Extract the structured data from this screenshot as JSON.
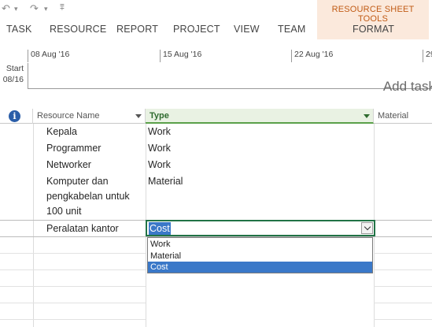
{
  "qat": {
    "undo_glyph": "↶",
    "undo_dd": "▾",
    "redo_glyph": "↷",
    "redo_dd": "▾",
    "customize_glyph": "⩱"
  },
  "ribbon": {
    "context_title": "RESOURCE SHEET TOOLS",
    "tabs": [
      "TASK",
      "RESOURCE",
      "REPORT",
      "PROJECT",
      "VIEW",
      "TEAM",
      "FORMAT"
    ]
  },
  "timeline": {
    "start_label": "Start",
    "start_date": "08/16",
    "ticks": [
      "08 Aug '16",
      "15 Aug '16",
      "22 Aug '16",
      "29"
    ],
    "add_tasks_text": "Add task"
  },
  "sheet": {
    "columns": {
      "indicators_icon": "i",
      "resource_name": "Resource Name",
      "type": "Type",
      "material": "Material"
    },
    "rows": [
      {
        "name": "Kepala",
        "type": "Work"
      },
      {
        "name": "Programmer",
        "type": "Work"
      },
      {
        "name": "Networker",
        "type": "Work"
      },
      {
        "name": "Komputer dan pengkabelan untuk 100 unit",
        "type": "Material"
      },
      {
        "name": "Peralatan kantor",
        "type": "Cost"
      }
    ],
    "editor_value": "Cost",
    "dropdown_options": [
      "Work",
      "Material",
      "Cost"
    ],
    "dropdown_selected": "Cost"
  },
  "colors": {
    "accent_green": "#217346",
    "context_tab_bg": "#fbe9dc",
    "context_tab_text": "#c15b15",
    "selection_blue": "#3a78c8"
  }
}
